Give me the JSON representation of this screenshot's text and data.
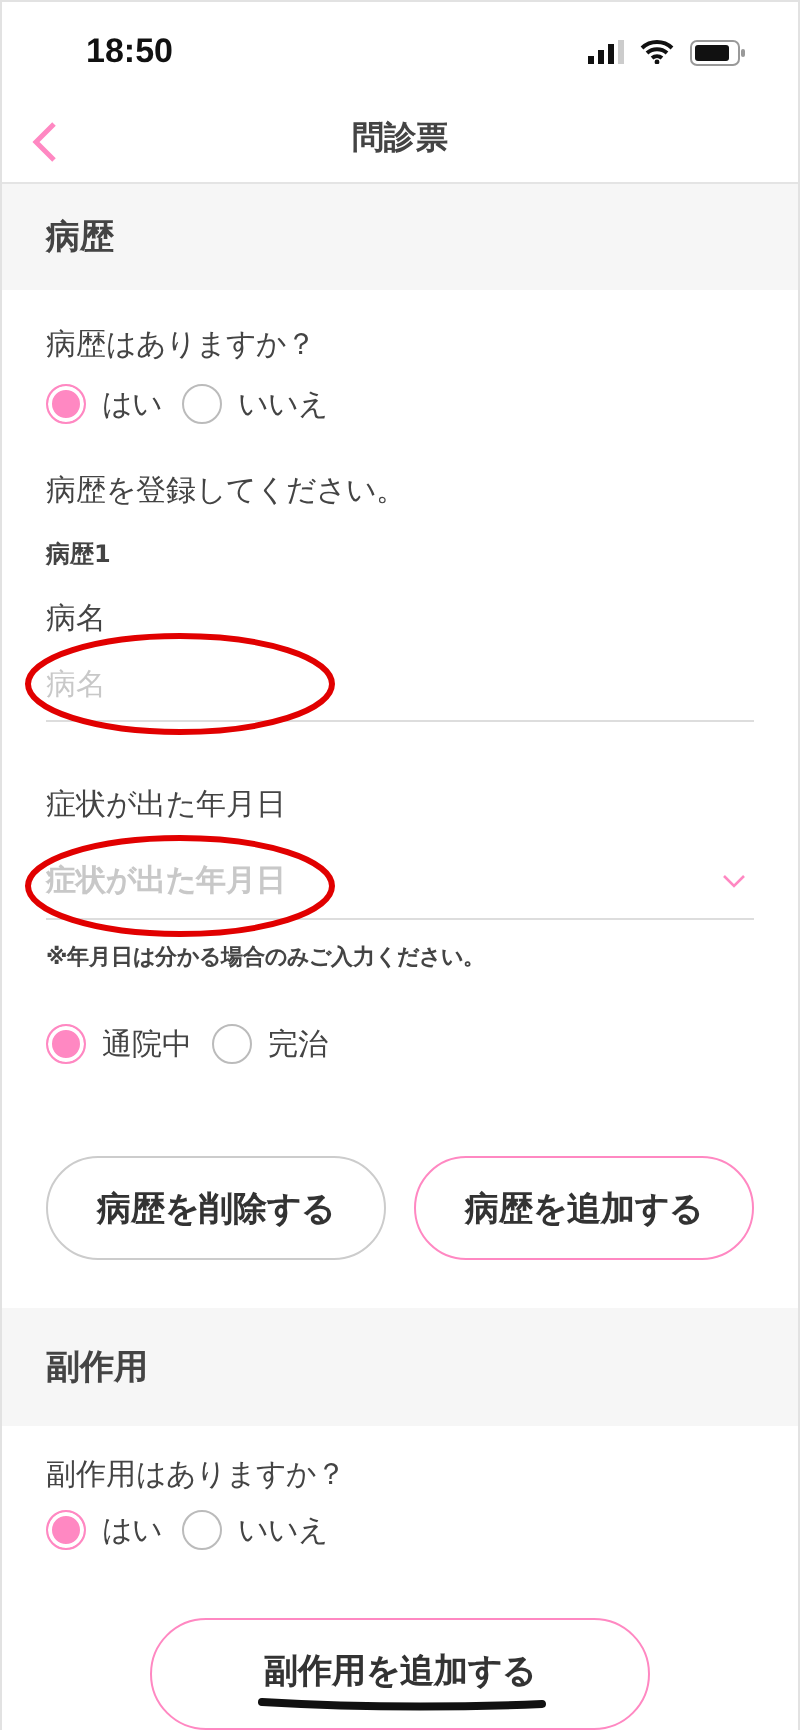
{
  "status_bar": {
    "time": "18:50"
  },
  "nav": {
    "title": "問診票"
  },
  "history": {
    "title": "病歴",
    "question": "病歴はありますか？",
    "answer_options": [
      {
        "label": "はい",
        "selected": true
      },
      {
        "label": "いいえ",
        "selected": false
      }
    ],
    "prompt": "病歴を登録してください。",
    "entry_label": "病歴1",
    "disease_field": {
      "label": "病名",
      "placeholder": "病名"
    },
    "date_field": {
      "label": "症状が出た年月日",
      "placeholder": "症状が出た年月日"
    },
    "note": "※年月日は分かる場合のみご入力ください。",
    "status_options": [
      {
        "label": "通院中",
        "selected": true
      },
      {
        "label": "完治",
        "selected": false
      }
    ],
    "buttons": [
      {
        "label": "病歴を削除する",
        "kind": "secondary"
      },
      {
        "label": "病歴を追加する",
        "kind": "primary"
      }
    ]
  },
  "side_effects": {
    "title": "副作用",
    "question": "副作用はありますか？",
    "answer_options": [
      {
        "label": "はい",
        "selected": true
      },
      {
        "label": "いいえ",
        "selected": false
      }
    ],
    "add_button": {
      "label": "副作用を追加する"
    }
  }
}
